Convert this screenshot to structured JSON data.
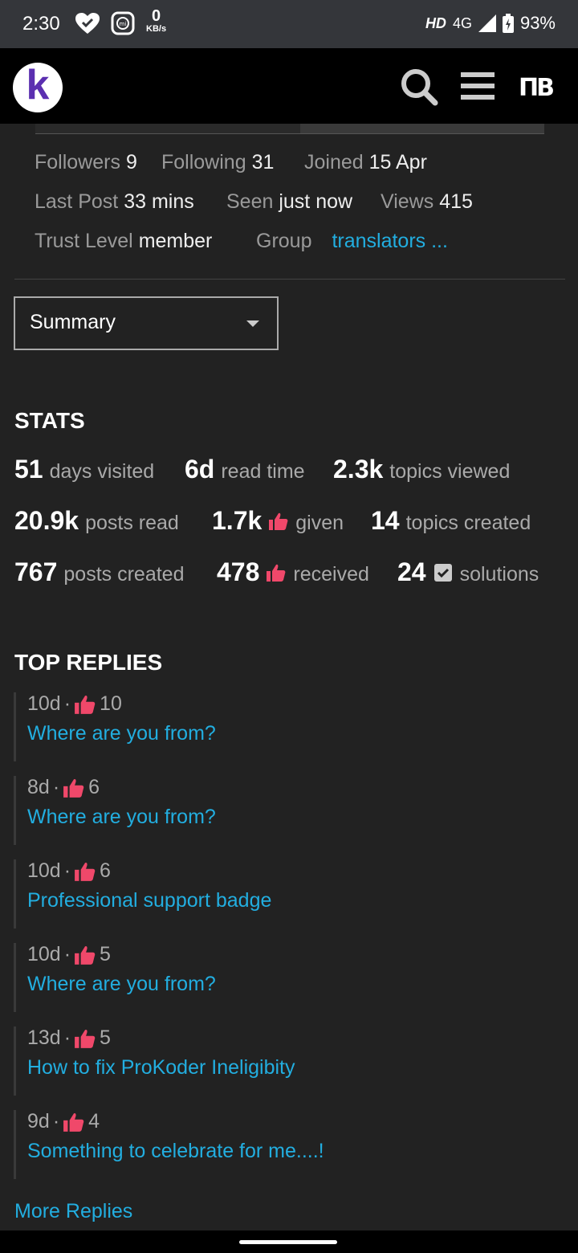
{
  "status_bar": {
    "time": "2:30",
    "net_speed_value": "0",
    "net_speed_unit": "KB/s",
    "hd": "HD",
    "network": "4G",
    "battery": "93%"
  },
  "topbar": {
    "logo_letter": "k",
    "avatar_text": "ΠB"
  },
  "profile_meta": {
    "followers_label": "Followers",
    "followers_value": "9",
    "following_label": "Following",
    "following_value": "31",
    "joined_label": "Joined",
    "joined_value": "15 Apr",
    "last_post_label": "Last Post",
    "last_post_value": "33 mins",
    "seen_label": "Seen",
    "seen_value": "just now",
    "views_label": "Views",
    "views_value": "415",
    "trust_label": "Trust Level",
    "trust_value": "member",
    "group_label": "Group",
    "group_value": "translators ..."
  },
  "summary_select": {
    "value": "Summary"
  },
  "stats": {
    "heading": "STATS",
    "items": [
      {
        "value": "51",
        "label": "days visited"
      },
      {
        "value": "6d",
        "label": "read time"
      },
      {
        "value": "2.3k",
        "label": "topics viewed"
      },
      {
        "value": "20.9k",
        "label": "posts read"
      },
      {
        "value": "1.7k",
        "label": "given",
        "icon": "thumbs-up-icon"
      },
      {
        "value": "14",
        "label": "topics created"
      },
      {
        "value": "767",
        "label": "posts created"
      },
      {
        "value": "478",
        "label": "received",
        "icon": "thumbs-up-icon"
      },
      {
        "value": "24",
        "label": "solutions",
        "icon": "checkbox-icon"
      }
    ]
  },
  "top_replies": {
    "heading": "TOP REPLIES",
    "items": [
      {
        "age": "10d",
        "likes": "10",
        "title": "Where are you from?"
      },
      {
        "age": "8d",
        "likes": "6",
        "title": "Where are you from?"
      },
      {
        "age": "10d",
        "likes": "6",
        "title": "Professional support badge"
      },
      {
        "age": "10d",
        "likes": "5",
        "title": "Where are you from?"
      },
      {
        "age": "13d",
        "likes": "5",
        "title": "How to fix ProKoder Ineligibity"
      },
      {
        "age": "9d",
        "likes": "4",
        "title": "Something to celebrate for me....!"
      }
    ],
    "more_label": "More Replies"
  },
  "colors": {
    "accent": "#22aee0",
    "like": "#f0486a",
    "background": "#222222"
  }
}
